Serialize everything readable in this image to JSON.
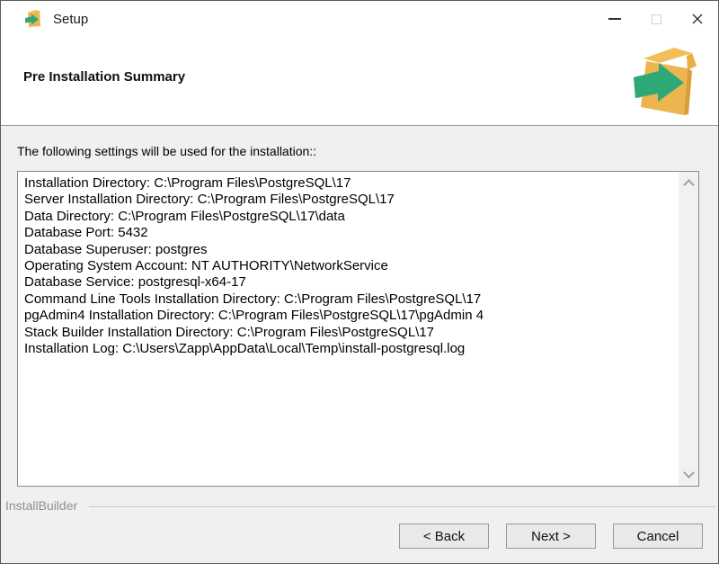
{
  "window": {
    "title": "Setup"
  },
  "header": {
    "title": "Pre Installation Summary"
  },
  "body": {
    "label": "The following settings will be used for the installation::",
    "summary_lines": [
      "Installation Directory: C:\\Program Files\\PostgreSQL\\17",
      "Server Installation Directory: C:\\Program Files\\PostgreSQL\\17",
      "Data Directory: C:\\Program Files\\PostgreSQL\\17\\data",
      "Database Port: 5432",
      "Database Superuser: postgres",
      "Operating System Account: NT AUTHORITY\\NetworkService",
      "Database Service: postgresql-x64-17",
      "Command Line Tools Installation Directory: C:\\Program Files\\PostgreSQL\\17",
      "pgAdmin4 Installation Directory: C:\\Program Files\\PostgreSQL\\17\\pgAdmin 4",
      "Stack Builder Installation Directory: C:\\Program Files\\PostgreSQL\\17",
      "Installation Log: C:\\Users\\Zapp\\AppData\\Local\\Temp\\install-postgresql.log"
    ]
  },
  "footer": {
    "brand": "InstallBuilder",
    "back_label": "< Back",
    "next_label": "Next >",
    "cancel_label": "Cancel"
  },
  "icons": {
    "app": "installbuilder-box-with-green-arrow",
    "minimize": "minimize-dash",
    "maximize": "maximize-square-disabled",
    "close": "close-x",
    "scroll_up": "chevron-up",
    "scroll_down": "chevron-down"
  },
  "colors": {
    "box_orange": "#EDB54F",
    "box_orange_light": "#F1BE58",
    "box_orange_dark": "#DA9C39",
    "arrow_green": "#2FA878",
    "arrow_green_dark": "#1E8A60",
    "body_gray": "#F0F0F0",
    "border_gray": "#898989"
  }
}
